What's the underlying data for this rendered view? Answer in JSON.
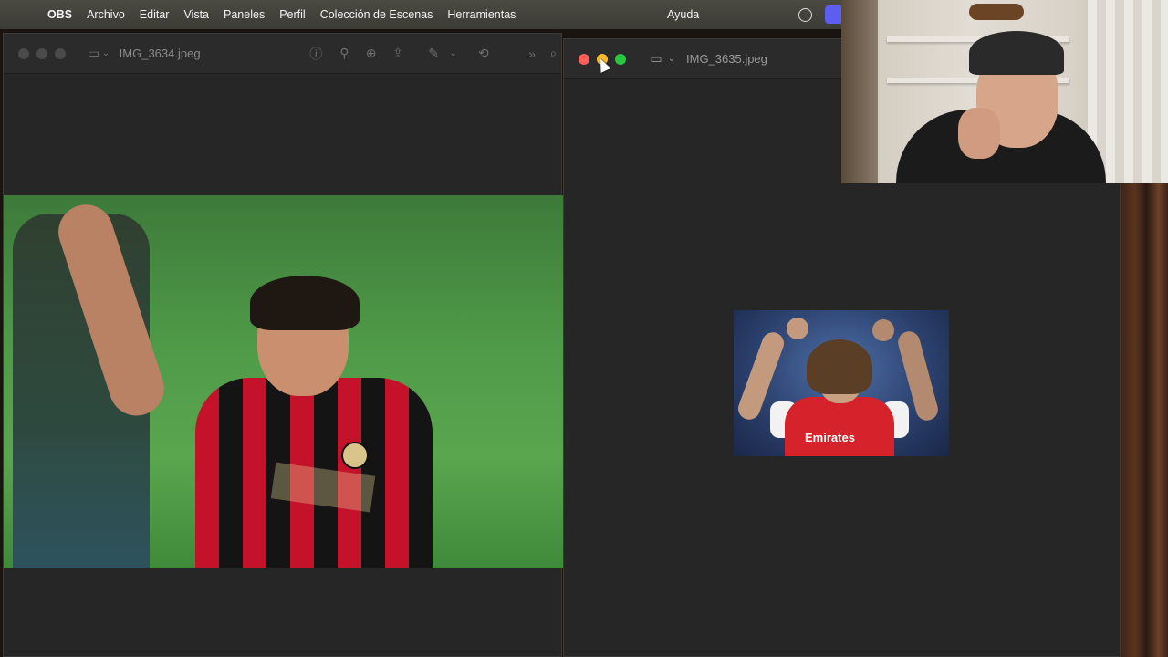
{
  "menubar": {
    "apple_icon": "apple-logo",
    "app_name": "OBS",
    "items": [
      "Archivo",
      "Editar",
      "Vista",
      "Paneles",
      "Perfil",
      "Colección de Escenas",
      "Herramientas"
    ],
    "help": "Ayuda"
  },
  "windows": {
    "left": {
      "title": "IMG_3634.jpeg",
      "toolbar_icons": [
        "sidebar-icon",
        "chevron-down-icon",
        "info-icon",
        "zoom-out-icon",
        "zoom-in-icon",
        "share-icon",
        "markup-icon",
        "chevron-down-icon",
        "rotate-icon",
        "more-icon",
        "search-icon"
      ]
    },
    "right": {
      "title": "IMG_3635.jpeg",
      "toolbar_icons": [
        "sidebar-icon",
        "chevron-down-icon",
        "info-icon"
      ]
    }
  },
  "photo_right": {
    "sponsor_text": "Emirates"
  },
  "colors": {
    "close": "#ff5f57",
    "minimize": "#febc2e",
    "maximize": "#28c840",
    "window_bg": "#262626"
  }
}
